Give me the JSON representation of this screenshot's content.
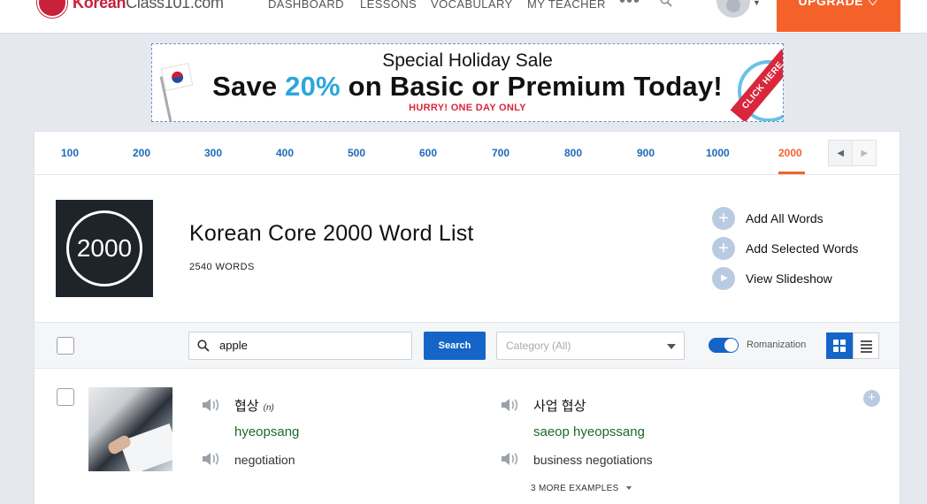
{
  "header": {
    "logo_text_brand": "Korean",
    "logo_text_rest": "Class101.com",
    "nav": [
      "DASHBOARD",
      "LESSONS",
      "VOCABULARY",
      "MY TEACHER"
    ],
    "more": "•••",
    "upgrade_label": "UPGRADE"
  },
  "banner": {
    "title": "Special Holiday Sale",
    "headline_pre": "Save ",
    "headline_pct": "20%",
    "headline_post": " on Basic or Premium Today!",
    "sub": "HURRY! ONE DAY ONLY",
    "cta": "CLICK HERE"
  },
  "levels": {
    "items": [
      "100",
      "200",
      "300",
      "400",
      "500",
      "600",
      "700",
      "800",
      "900",
      "1000",
      "2000"
    ],
    "active": "2000",
    "prev": "◀",
    "next": "▶"
  },
  "wordlist": {
    "badge": "2000",
    "title": "Korean Core 2000 Word List",
    "count": "2540 WORDS",
    "actions": {
      "add_all": "Add All Words",
      "add_selected": "Add Selected Words",
      "slideshow": "View Slideshow"
    }
  },
  "toolbar": {
    "search_value": "apple",
    "search_button": "Search",
    "category_value": "Category (All)",
    "romanization_label": "Romanization",
    "romanization_on": true
  },
  "word": {
    "korean": "협상",
    "pos": "(n)",
    "romanization": "hyeopsang",
    "english": "negotiation",
    "example_korean": "사업 협상",
    "example_romanization": "saeop hyeopssang",
    "example_english": "business negotiations",
    "more_examples": "3 MORE EXAMPLES"
  },
  "colors": {
    "accent_orange": "#f4622a",
    "link_blue": "#1c6bb8",
    "primary_blue": "#1565c8",
    "romanization_green": "#1b6b2a",
    "sale_cyan": "#2ba6dc",
    "sale_red": "#d9263b"
  },
  "icons": [
    "logo-icon",
    "search-icon",
    "avatar-icon",
    "chevron-down-icon",
    "flag-icon",
    "plus-icon",
    "play-icon",
    "speaker-icon",
    "grid-view-icon",
    "list-view-icon"
  ]
}
